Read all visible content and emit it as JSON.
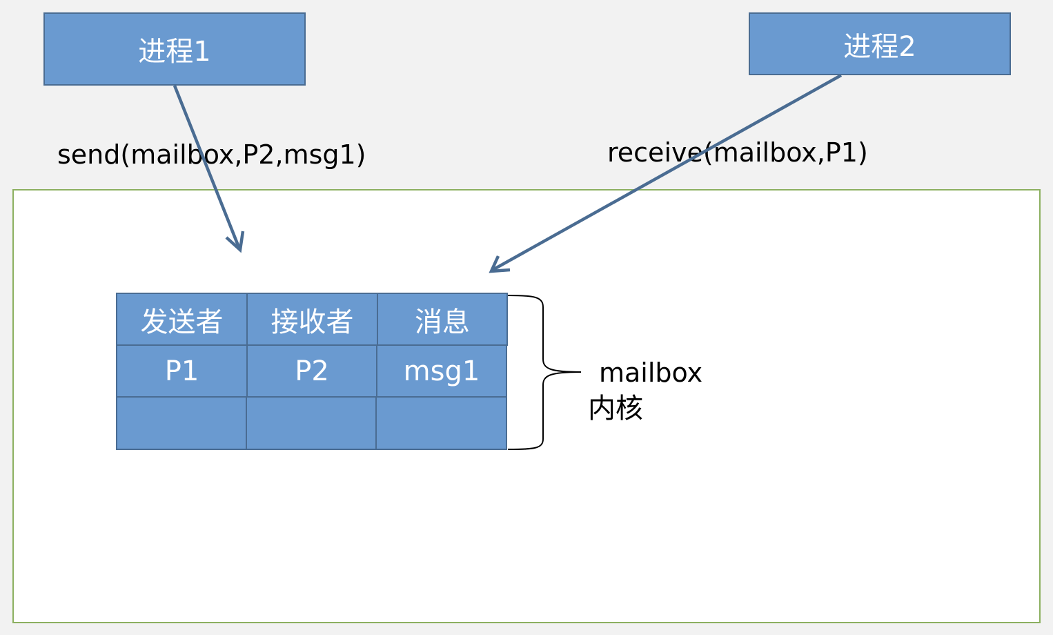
{
  "processes": {
    "p1_label": "进程1",
    "p2_label": "进程2"
  },
  "calls": {
    "send": "send(mailbox,P2,msg1)",
    "receive": "receive(mailbox,P1)"
  },
  "mailbox_table": {
    "headers": [
      "发送者",
      "接收者",
      "消息"
    ],
    "rows": [
      [
        "P1",
        "P2",
        "msg1"
      ],
      [
        "",
        "",
        ""
      ]
    ]
  },
  "labels": {
    "mailbox": "mailbox",
    "kernel": "内核"
  },
  "colors": {
    "box_fill": "#6a9ad0",
    "box_border": "#4a6c92",
    "arrow": "#4a6c92",
    "kernel_border": "#8cb060",
    "background": "#f2f2f2"
  }
}
